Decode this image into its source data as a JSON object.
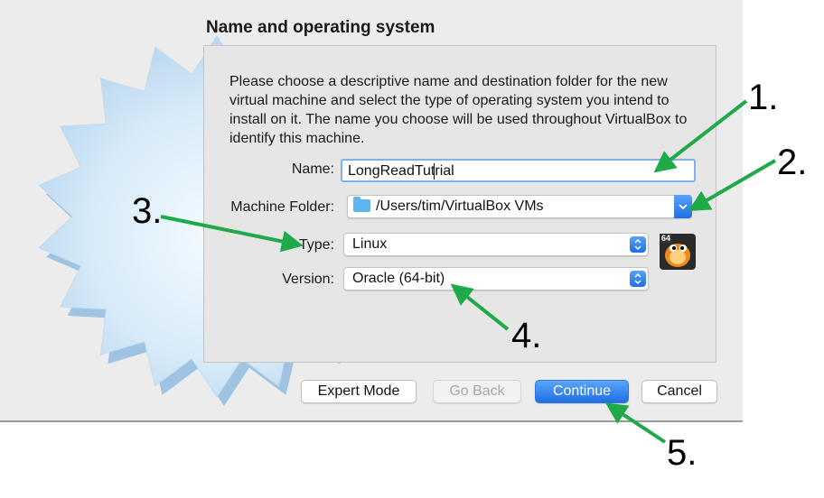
{
  "dialog": {
    "section_title": "Name and operating system",
    "description": "Please choose a descriptive name and destination folder for the new virtual machine and select the type of operating system you intend to install on it. The name you choose will be used throughout VirtualBox to identify this machine."
  },
  "form": {
    "name_label": "Name:",
    "name_value_before_caret": "LongReadTut",
    "name_value_after_caret": "rial",
    "folder_label": "Machine Folder:",
    "folder_value": "/Users/tim/VirtualBox VMs",
    "type_label": "Type:",
    "type_value": "Linux",
    "version_label": "Version:",
    "version_value": "Oracle (64-bit)",
    "os_icon": "tux-penguin-icon",
    "os_badge": "64"
  },
  "buttons": {
    "expert_mode": "Expert Mode",
    "go_back": "Go Back",
    "continue": "Continue",
    "cancel": "Cancel"
  },
  "annotations": {
    "one": "1.",
    "two": "2.",
    "three": "3.",
    "four": "4.",
    "five": "5.",
    "arrow_color": "#1faa4a"
  },
  "colors": {
    "accent": "#1f6fe4",
    "focus_ring": "#7fb0ef"
  }
}
